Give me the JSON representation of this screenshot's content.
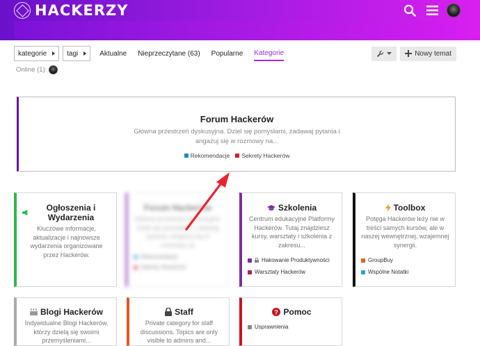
{
  "header": {
    "logo_text": "HACKERZY",
    "brand_color": "#9b1be0",
    "icons": [
      "search-icon",
      "hamburger-menu-icon",
      "user-avatar"
    ]
  },
  "nav": {
    "category_dropdown": "kategorie",
    "tag_dropdown": "tagi",
    "links": [
      "Aktualne",
      "Nieprzeczytane (63)",
      "Popularne",
      "Kategorie"
    ],
    "active": "Kategorie",
    "new_topic": "Nowy temat",
    "online": "Online (1):"
  },
  "featured": {
    "title": "Forum Hackerów",
    "description": "Główna przestrzeń dyskusyjna. Dziel się pomysłami, zadawaj pytania i angażuj się w rozmowy na...",
    "subcategories": [
      {
        "label": "Rekomendacje",
        "color": "#1e88c9"
      },
      {
        "label": "Sekrety Hackerów",
        "color": "#d1232a"
      }
    ]
  },
  "cards": {
    "ogloszenia": {
      "title": "Ogłoszenia i Wydarzenia",
      "description": "Kluczowe informacje, aktualizacje i najnowsze wydarzenia organizowane przez Hackerów.",
      "color": "#2eb84b"
    },
    "forum_blur": {
      "title": "Forum Hackerów",
      "description": "Główna przestrzeń dyskusyjna. Dziel się pomysłami, zadawaj pytania i angażuj się w rozmowy na",
      "sub1": "Rekomendacje",
      "sub2": "Sekrety Hackerów"
    },
    "szkolenia": {
      "title": "Szkolenia",
      "description": "Centrum edukacyjne Platformy Hackerów. Tutaj znajdziesz kursy, warsztaty i szkolenia z zakresu...",
      "color": "#7a2fa0",
      "subcategories": [
        {
          "label": "Hakowanie Produktywności",
          "color": "#7a2fa0"
        },
        {
          "label": "Warsztaty Hackerów",
          "color": "#b0205a"
        }
      ]
    },
    "toolbox": {
      "title": "Toolbox",
      "description": "Potęga Hackerów leży nie w treści samych kursów, ale w naszej wewnętrznej, wzajemnej synergii.",
      "color": "#111111",
      "subcategories": [
        {
          "label": "GroupBuy",
          "color": "#e0602a"
        },
        {
          "label": "Wspólne Notatki",
          "color": "#2aa3db"
        }
      ]
    },
    "blogi": {
      "title": "Blogi Hackerów",
      "description": "Indywidualne Blogi Hackerów, którzy dzielą się swoimi przemyśleniami...",
      "color": "#aaaaaa"
    },
    "staff": {
      "title": "Staff",
      "description": "Private category for staff discussions. Topics are only visible to admins and...",
      "color": "#e0542a"
    },
    "pomoc": {
      "title": "Pomoc",
      "color": "#c8141a",
      "subcategories": [
        {
          "label": "Usprawnienia",
          "color": "#888888"
        }
      ]
    }
  }
}
